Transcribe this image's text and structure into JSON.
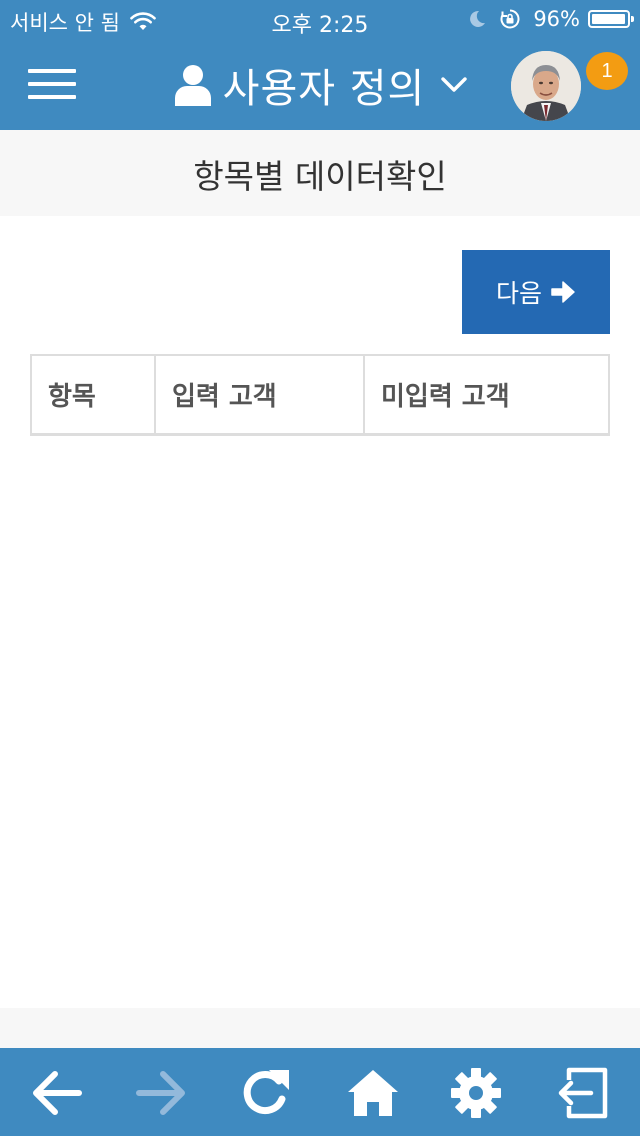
{
  "status_bar": {
    "carrier": "서비스 안 됨",
    "time": "오후 2:25",
    "battery_percent": "96%",
    "battery_level": 0.96
  },
  "header": {
    "title": "사용자 정의",
    "notification_count": "1",
    "menu_icon": "hamburger-menu-icon",
    "user_icon": "user-icon",
    "dropdown_icon": "chevron-down-icon"
  },
  "page": {
    "title": "항목별 데이터확인",
    "next_label": "다음"
  },
  "table": {
    "columns": [
      "항목",
      "입력 고객",
      "미입력 고객"
    ],
    "rows": []
  },
  "bottom_nav": {
    "items": [
      "back-arrow-icon",
      "forward-arrow-icon",
      "refresh-icon",
      "home-icon",
      "gear-icon",
      "logout-icon"
    ]
  },
  "colors": {
    "header_bg": "#3f8ac0",
    "button_bg": "#2469b3",
    "badge_bg": "#f39c12",
    "forward_disabled": "#93b9db"
  }
}
